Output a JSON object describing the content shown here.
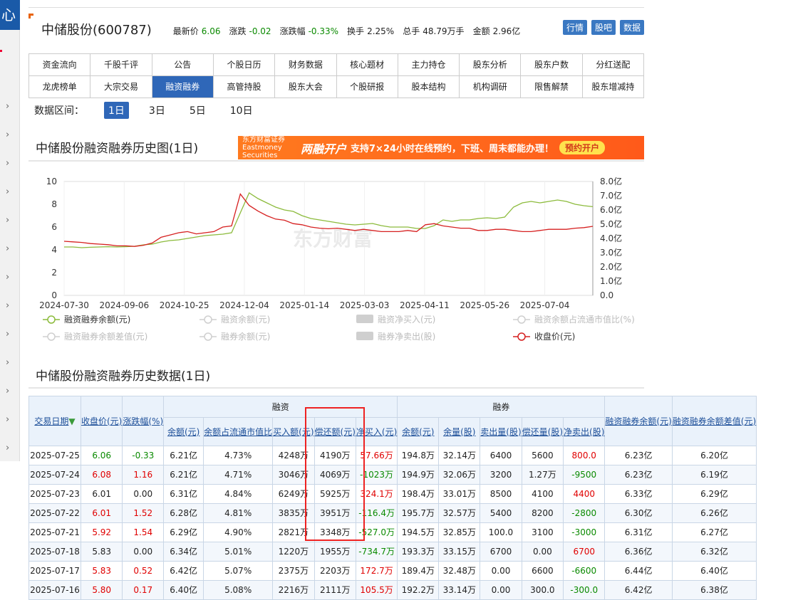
{
  "rail": {
    "head_char": "心",
    "chevron": "›"
  },
  "header": {
    "stock_name": "中储股份(600787)",
    "quote": [
      {
        "label": "最新价",
        "value": "6.06",
        "color": "green"
      },
      {
        "label": "涨跌",
        "value": "-0.02",
        "color": "green"
      },
      {
        "label": "涨跌幅",
        "value": "-0.33%",
        "color": "green"
      },
      {
        "label": "换手",
        "value": "2.25%",
        "color": ""
      },
      {
        "label": "总手",
        "value": "48.79万手",
        "color": ""
      },
      {
        "label": "金额",
        "value": "2.96亿",
        "color": ""
      }
    ],
    "buttons": [
      "行情",
      "股吧",
      "数据"
    ]
  },
  "nav": {
    "row1": [
      "资金流向",
      "千股千评",
      "公告",
      "个股日历",
      "财务数据",
      "核心题材",
      "主力持仓",
      "股东分析",
      "股东户数",
      "分红送配"
    ],
    "row2": [
      "龙虎榜单",
      "大宗交易",
      "融资融券",
      "高管持股",
      "股东大会",
      "个股研报",
      "股本结构",
      "机构调研",
      "限售解禁",
      "股东增减持"
    ],
    "active": "融资融券"
  },
  "range": {
    "label": "数据区间：",
    "options": [
      "1日",
      "3日",
      "5日",
      "10日"
    ],
    "active": "1日"
  },
  "chart_section": {
    "title": "中储股份融资融券历史图(1日)"
  },
  "banner": {
    "brand": "东方财富证券 Eastmoney Securities",
    "big": "两融开户",
    "text": "支持7×24小时在线预约，下班、周末都能办理！",
    "button": "预约开户"
  },
  "watermark": "东方财富",
  "chart_data": {
    "type": "line",
    "x_ticks": [
      "2024-07-30",
      "2024-09-06",
      "2024-10-25",
      "2024-12-04",
      "2025-01-14",
      "2025-03-03",
      "2025-04-11",
      "2025-05-26",
      "2025-07-04"
    ],
    "y_left": {
      "ticks": [
        "0",
        "2",
        "4",
        "6",
        "8",
        "10"
      ],
      "range": [
        0,
        10
      ]
    },
    "y_right": {
      "ticks": [
        "0.0",
        "1.0亿",
        "2.0亿",
        "3.0亿",
        "4.0亿",
        "5.0亿",
        "6.0亿",
        "7.0亿",
        "8.0亿"
      ],
      "range": [
        0,
        8
      ]
    },
    "series": [
      {
        "name": "融资融券余额(元)",
        "axis": "right",
        "color": "#8cbb3c",
        "values": [
          3.4,
          3.4,
          3.35,
          3.38,
          3.4,
          3.42,
          3.4,
          3.42,
          3.45,
          3.55,
          3.6,
          3.75,
          3.85,
          3.9,
          4.0,
          4.1,
          4.2,
          4.25,
          4.3,
          4.4,
          5.8,
          7.2,
          6.8,
          6.5,
          6.2,
          6.0,
          5.9,
          5.6,
          5.4,
          5.3,
          5.2,
          5.1,
          5.0,
          4.95,
          5.0,
          5.05,
          4.9,
          4.8,
          4.8,
          4.8,
          4.7,
          4.7,
          4.9,
          5.3,
          5.2,
          5.3,
          5.3,
          5.4,
          5.45,
          5.4,
          5.5,
          6.2,
          6.5,
          6.6,
          6.5,
          6.6,
          6.7,
          6.6,
          6.4,
          6.3,
          6.23
        ]
      },
      {
        "name": "收盘价(元)",
        "axis": "left",
        "color": "#d62020",
        "values": [
          4.75,
          4.7,
          4.65,
          4.55,
          4.5,
          4.45,
          4.35,
          4.35,
          4.3,
          4.4,
          4.6,
          5.1,
          5.3,
          5.5,
          5.6,
          5.4,
          5.5,
          5.6,
          6.0,
          6.1,
          8.9,
          7.9,
          7.4,
          7.0,
          6.7,
          6.6,
          6.3,
          6.2,
          6.0,
          5.9,
          5.85,
          5.9,
          5.8,
          5.7,
          5.8,
          5.7,
          5.6,
          5.6,
          5.6,
          5.7,
          5.6,
          6.2,
          6.3,
          6.1,
          6.0,
          5.9,
          5.9,
          5.7,
          5.7,
          5.8,
          5.8,
          5.7,
          5.6,
          5.6,
          5.7,
          5.8,
          5.8,
          5.8,
          5.9,
          5.95,
          6.06
        ]
      }
    ],
    "legend": [
      {
        "label": "融资融券余额(元)",
        "active": true,
        "color": "#8cbb3c",
        "kind": "line"
      },
      {
        "label": "融资余额(元)",
        "active": false,
        "kind": "line"
      },
      {
        "label": "融资净买入(元)",
        "active": false,
        "kind": "bar"
      },
      {
        "label": "融资余额占流通市值比(%)",
        "active": false,
        "kind": "line"
      },
      {
        "label": "融资融券余额差值(元)",
        "active": false,
        "kind": "line"
      },
      {
        "label": "融券余额(元)",
        "active": false,
        "kind": "line"
      },
      {
        "label": "融券净卖出(股)",
        "active": false,
        "kind": "bar"
      },
      {
        "label": "收盘价(元)",
        "active": true,
        "color": "#d62020",
        "kind": "line"
      }
    ]
  },
  "table_section": {
    "title": "中储股份融资融券历史数据(1日)"
  },
  "table": {
    "h_date": "交易日期",
    "h_close": "收盘价(元)",
    "h_chg": "涨跌幅(%)",
    "h_rz": "融资",
    "h_rq": "融券",
    "h_total": "融资融券余额(元)",
    "h_diff": "融资融券余额差值(元)",
    "rz_cols": [
      "余额(元)",
      "余额占流通市值比",
      "买入额(元)",
      "偿还额(元)",
      "净买入(元)"
    ],
    "rq_cols": [
      "余额(元)",
      "余量(股)",
      "卖出量(股)",
      "偿还量(股)",
      "净卖出(股)"
    ],
    "rows": [
      {
        "date": "2025-07-25",
        "close": "6.06",
        "chg": "-0.33",
        "rz_bal": "6.21亿",
        "rz_pct": "4.73%",
        "buy": "4248万",
        "repay": "4190万",
        "net": "57.66万",
        "rq_bal": "194.8万",
        "rq_vol": "32.14万",
        "sell": "6400",
        "rq_repay": "5600",
        "net_sell": "800.0",
        "total": "6.23亿",
        "diff": "6.20亿",
        "dir": "down",
        "net_dir": "up",
        "ns_dir": "up"
      },
      {
        "date": "2025-07-24",
        "close": "6.08",
        "chg": "1.16",
        "rz_bal": "6.21亿",
        "rz_pct": "4.71%",
        "buy": "3046万",
        "repay": "4069万",
        "net": "-1023万",
        "rq_bal": "194.9万",
        "rq_vol": "32.06万",
        "sell": "3200",
        "rq_repay": "1.27万",
        "net_sell": "-9500",
        "total": "6.23亿",
        "diff": "6.19亿",
        "dir": "up",
        "net_dir": "down",
        "ns_dir": "down"
      },
      {
        "date": "2025-07-23",
        "close": "6.01",
        "chg": "0.00",
        "rz_bal": "6.31亿",
        "rz_pct": "4.84%",
        "buy": "6249万",
        "repay": "5925万",
        "net": "324.1万",
        "rq_bal": "198.4万",
        "rq_vol": "33.01万",
        "sell": "8500",
        "rq_repay": "4100",
        "net_sell": "4400",
        "total": "6.33亿",
        "diff": "6.29亿",
        "dir": "flat",
        "net_dir": "up",
        "ns_dir": "up"
      },
      {
        "date": "2025-07-22",
        "close": "6.01",
        "chg": "1.52",
        "rz_bal": "6.28亿",
        "rz_pct": "4.81%",
        "buy": "3835万",
        "repay": "3951万",
        "net": "-116.4万",
        "rq_bal": "195.7万",
        "rq_vol": "32.57万",
        "sell": "5400",
        "rq_repay": "8200",
        "net_sell": "-2800",
        "total": "6.30亿",
        "diff": "6.26亿",
        "dir": "up",
        "net_dir": "down",
        "ns_dir": "down"
      },
      {
        "date": "2025-07-21",
        "close": "5.92",
        "chg": "1.54",
        "rz_bal": "6.29亿",
        "rz_pct": "4.90%",
        "buy": "2821万",
        "repay": "3348万",
        "net": "-527.0万",
        "rq_bal": "194.5万",
        "rq_vol": "32.85万",
        "sell": "100.0",
        "rq_repay": "3100",
        "net_sell": "-3000",
        "total": "6.31亿",
        "diff": "6.27亿",
        "dir": "up",
        "net_dir": "down",
        "ns_dir": "down"
      },
      {
        "date": "2025-07-18",
        "close": "5.83",
        "chg": "0.00",
        "rz_bal": "6.34亿",
        "rz_pct": "5.01%",
        "buy": "1220万",
        "repay": "1955万",
        "net": "-734.7万",
        "rq_bal": "193.3万",
        "rq_vol": "33.15万",
        "sell": "6700",
        "rq_repay": "0.00",
        "net_sell": "6700",
        "total": "6.36亿",
        "diff": "6.32亿",
        "dir": "flat",
        "net_dir": "down",
        "ns_dir": "up"
      },
      {
        "date": "2025-07-17",
        "close": "5.83",
        "chg": "0.52",
        "rz_bal": "6.42亿",
        "rz_pct": "5.07%",
        "buy": "2375万",
        "repay": "2203万",
        "net": "172.7万",
        "rq_bal": "189.4万",
        "rq_vol": "32.48万",
        "sell": "0.00",
        "rq_repay": "6600",
        "net_sell": "-6600",
        "total": "6.44亿",
        "diff": "6.40亿",
        "dir": "up",
        "net_dir": "up",
        "ns_dir": "down"
      },
      {
        "date": "2025-07-16",
        "close": "5.80",
        "chg": "0.17",
        "rz_bal": "6.40亿",
        "rz_pct": "5.08%",
        "buy": "2216万",
        "repay": "2111万",
        "net": "105.5万",
        "rq_bal": "192.2万",
        "rq_vol": "33.14万",
        "sell": "0.00",
        "rq_repay": "300.0",
        "net_sell": "-300.0",
        "total": "6.42亿",
        "diff": "6.38亿",
        "dir": "up",
        "net_dir": "up",
        "ns_dir": "down"
      }
    ]
  },
  "colors": {
    "up": "#e00000",
    "down": "#0a8a00",
    "accent": "#2f67b8",
    "highlight": "#e22222"
  }
}
